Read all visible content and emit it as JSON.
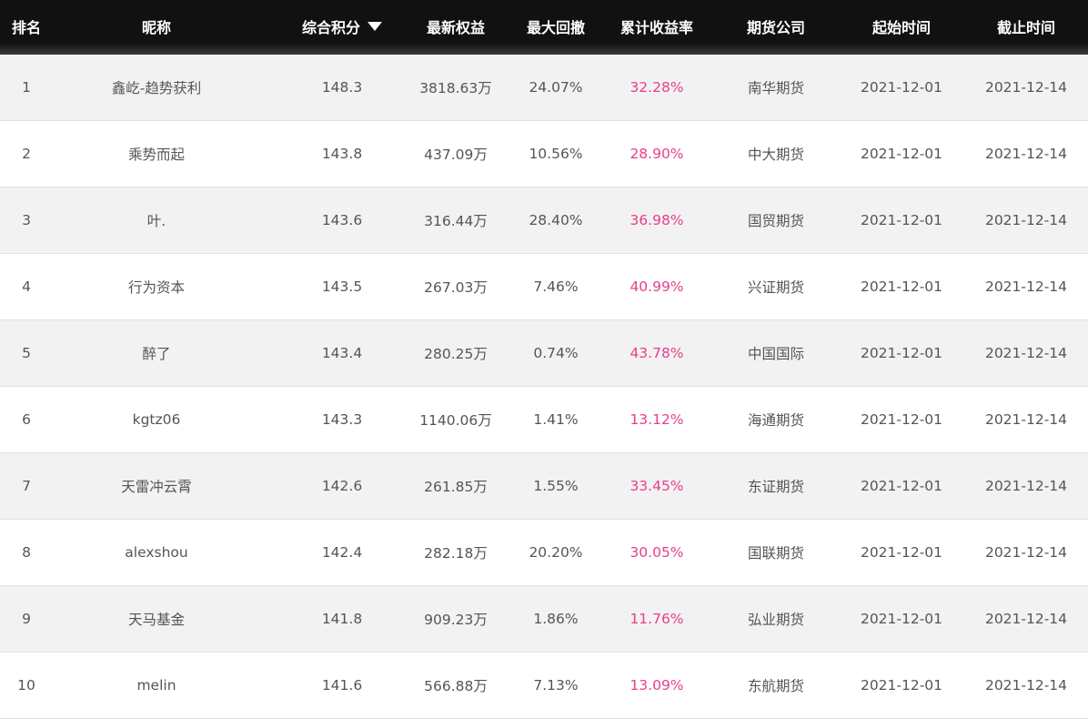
{
  "columns": {
    "rank": "排名",
    "nickname": "昵称",
    "score": "综合积分",
    "equity": "最新权益",
    "drawdown": "最大回撤",
    "return": "累计收益率",
    "company": "期货公司",
    "start": "起始时间",
    "end": "截止时间"
  },
  "sort_icon": "sort-desc-icon",
  "colors": {
    "header_bg": "#111111",
    "return_text": "#e83e8c",
    "stripe": "#f2f2f2"
  },
  "rows": [
    {
      "rank": "1",
      "nickname": "鑫屹-趋势获利",
      "score": "148.3",
      "equity": "3818.63万",
      "drawdown": "24.07%",
      "return": "32.28%",
      "company": "南华期货",
      "start": "2021-12-01",
      "end": "2021-12-14"
    },
    {
      "rank": "2",
      "nickname": "乘势而起",
      "score": "143.8",
      "equity": "437.09万",
      "drawdown": "10.56%",
      "return": "28.90%",
      "company": "中大期货",
      "start": "2021-12-01",
      "end": "2021-12-14"
    },
    {
      "rank": "3",
      "nickname": "叶.",
      "score": "143.6",
      "equity": "316.44万",
      "drawdown": "28.40%",
      "return": "36.98%",
      "company": "国贸期货",
      "start": "2021-12-01",
      "end": "2021-12-14"
    },
    {
      "rank": "4",
      "nickname": "行为资本",
      "score": "143.5",
      "equity": "267.03万",
      "drawdown": "7.46%",
      "return": "40.99%",
      "company": "兴证期货",
      "start": "2021-12-01",
      "end": "2021-12-14"
    },
    {
      "rank": "5",
      "nickname": "醉了",
      "score": "143.4",
      "equity": "280.25万",
      "drawdown": "0.74%",
      "return": "43.78%",
      "company": "中国国际",
      "start": "2021-12-01",
      "end": "2021-12-14"
    },
    {
      "rank": "6",
      "nickname": "kgtz06",
      "score": "143.3",
      "equity": "1140.06万",
      "drawdown": "1.41%",
      "return": "13.12%",
      "company": "海通期货",
      "start": "2021-12-01",
      "end": "2021-12-14"
    },
    {
      "rank": "7",
      "nickname": "天雷冲云霄",
      "score": "142.6",
      "equity": "261.85万",
      "drawdown": "1.55%",
      "return": "33.45%",
      "company": "东证期货",
      "start": "2021-12-01",
      "end": "2021-12-14"
    },
    {
      "rank": "8",
      "nickname": "alexshou",
      "score": "142.4",
      "equity": "282.18万",
      "drawdown": "20.20%",
      "return": "30.05%",
      "company": "国联期货",
      "start": "2021-12-01",
      "end": "2021-12-14"
    },
    {
      "rank": "9",
      "nickname": "天马基金",
      "score": "141.8",
      "equity": "909.23万",
      "drawdown": "1.86%",
      "return": "11.76%",
      "company": "弘业期货",
      "start": "2021-12-01",
      "end": "2021-12-14"
    },
    {
      "rank": "10",
      "nickname": "melin",
      "score": "141.6",
      "equity": "566.88万",
      "drawdown": "7.13%",
      "return": "13.09%",
      "company": "东航期货",
      "start": "2021-12-01",
      "end": "2021-12-14"
    }
  ]
}
